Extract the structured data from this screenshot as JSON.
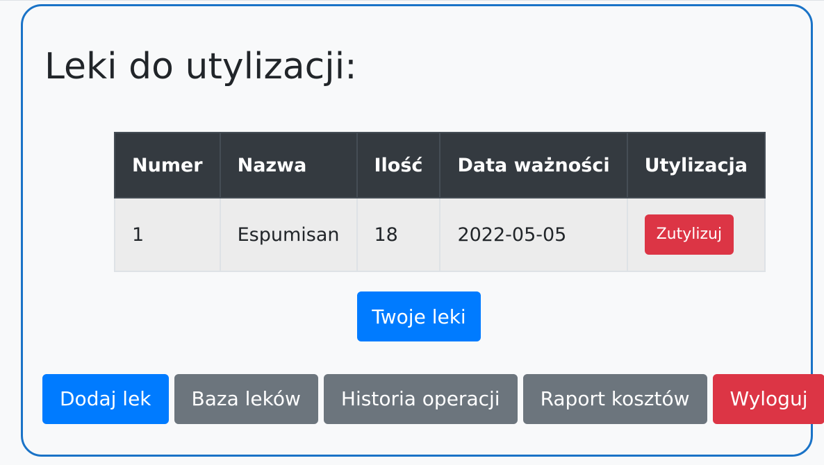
{
  "title": "Leki do utylizacji:",
  "table": {
    "headers": [
      "Numer",
      "Nazwa",
      "Ilość",
      "Data ważności",
      "Utylizacja"
    ],
    "rows": [
      {
        "number": "1",
        "name": "Espumisan",
        "quantity": "18",
        "expiry_date": "2022-05-05",
        "action_label": "Zutylizuj"
      }
    ]
  },
  "your_meds_label": "Twoje leki",
  "nav": {
    "add_label": "Dodaj lek",
    "database_label": "Baza leków",
    "history_label": "Historia operacji",
    "report_label": "Raport kosztów",
    "logout_label": "Wyloguj"
  },
  "colors": {
    "primary": "#007bff",
    "secondary": "#6c757d",
    "danger": "#dc3545",
    "card_border": "#1a73c7",
    "table_header": "#343a40",
    "expired_text": "#e3000f"
  }
}
